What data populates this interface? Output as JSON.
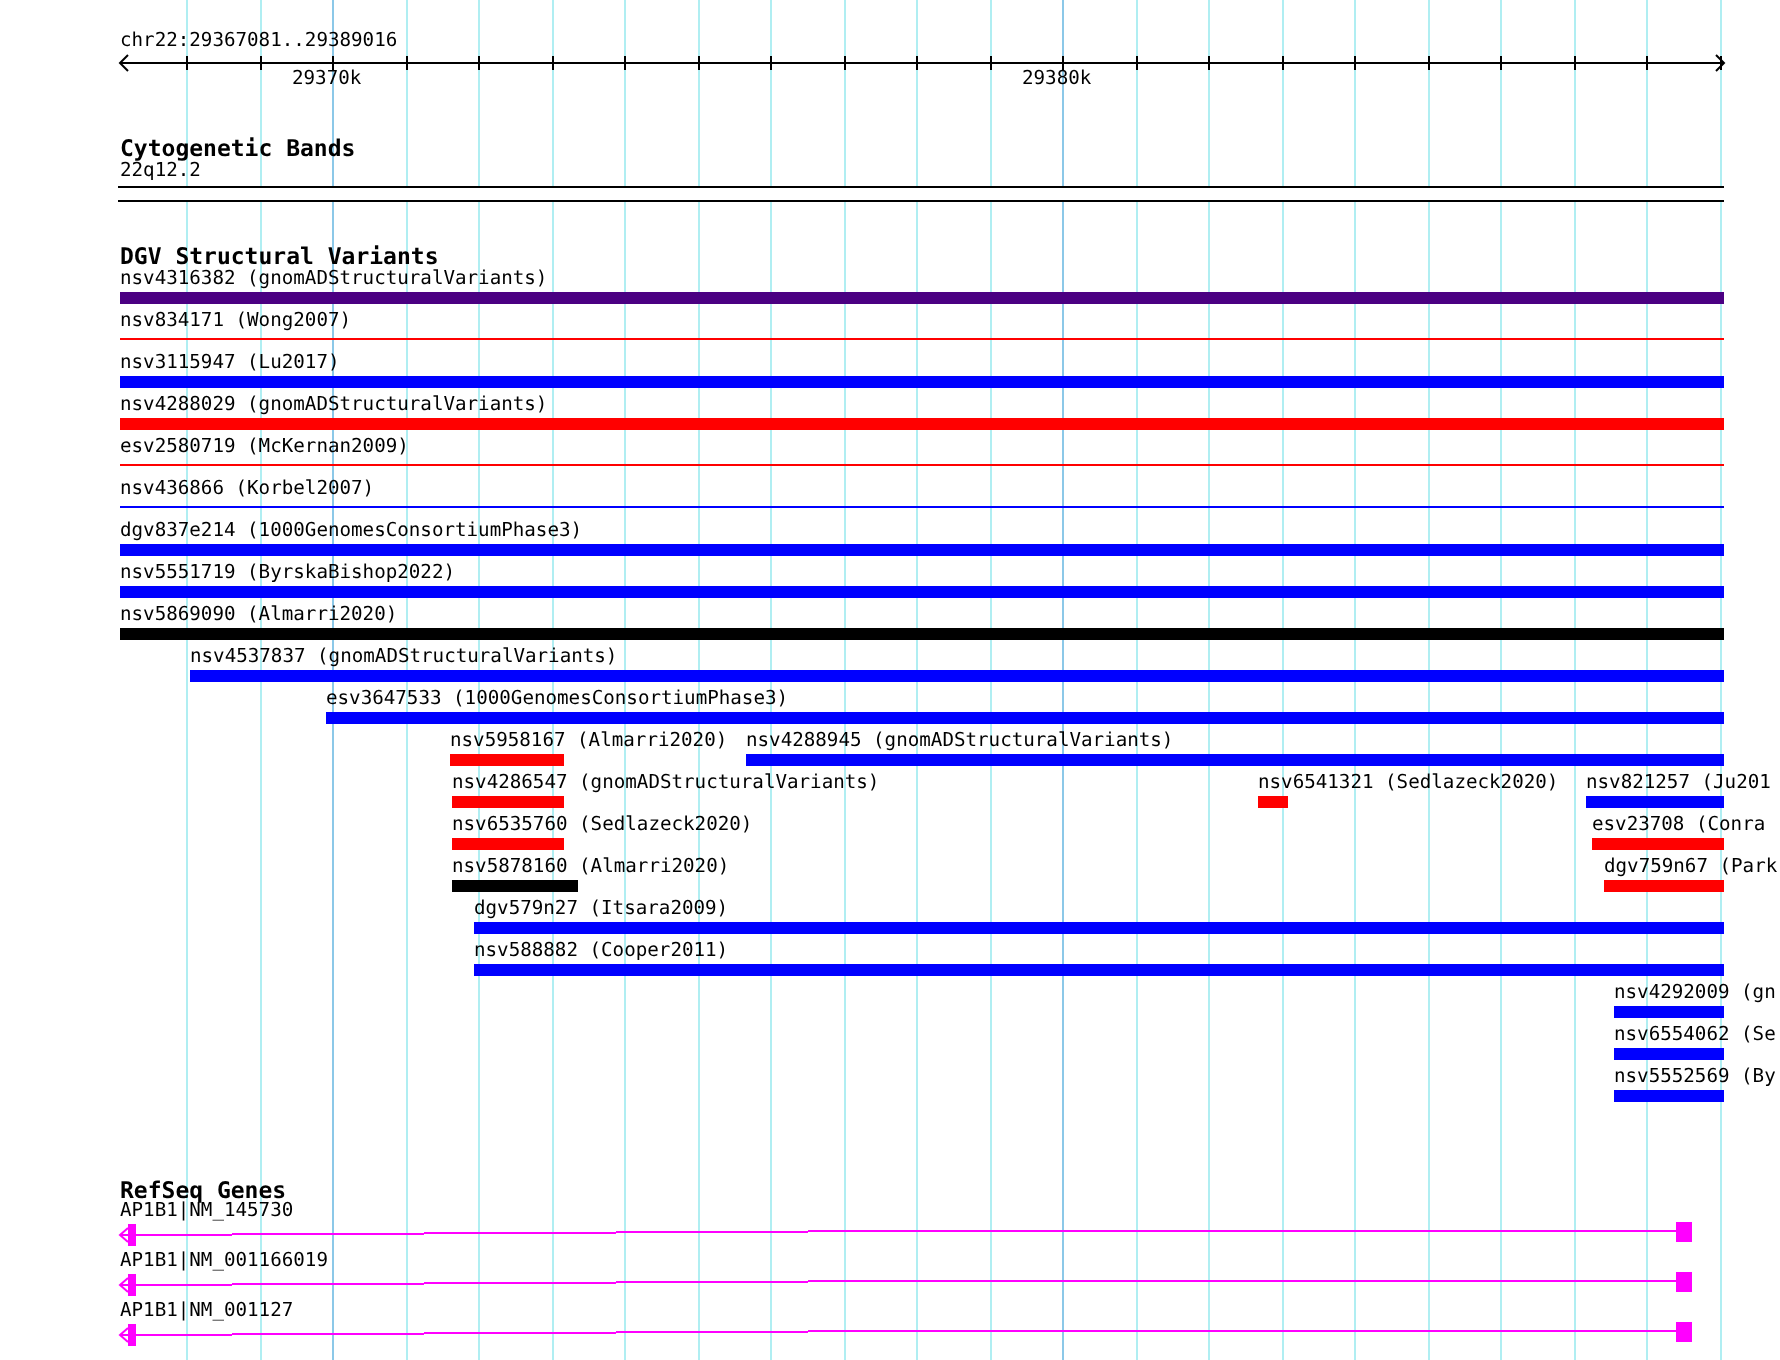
{
  "ruler": {
    "region": "chr22:29367081..29389016",
    "ticks": [
      {
        "label": "29370k"
      },
      {
        "label": "29380k"
      }
    ]
  },
  "tracks": [
    {
      "kind": "bands",
      "title": "Cytogenetic Bands",
      "features": [
        {
          "label": "22q12.2"
        }
      ]
    },
    {
      "kind": "variants",
      "title": "DGV Structural Variants",
      "rows": [
        [
          {
            "label": "nsv4316382 (gnomADStructuralVariants)",
            "color": "#4b0082",
            "kind": "thick"
          }
        ],
        [
          {
            "label": "nsv834171 (Wong2007)",
            "color": "#ff0000",
            "kind": "thin"
          }
        ],
        [
          {
            "label": "nsv3115947 (Lu2017)",
            "color": "#0000ff",
            "kind": "thick"
          }
        ],
        [
          {
            "label": "nsv4288029 (gnomADStructuralVariants)",
            "color": "#ff0000",
            "kind": "thick"
          }
        ],
        [
          {
            "label": "esv2580719 (McKernan2009)",
            "color": "#ff0000",
            "kind": "thin"
          }
        ],
        [
          {
            "label": "nsv436866 (Korbel2007)",
            "color": "#0000ff",
            "kind": "thin"
          }
        ],
        [
          {
            "label": "dgv837e214 (1000GenomesConsortiumPhase3)",
            "color": "#0000ff",
            "kind": "thick"
          }
        ],
        [
          {
            "label": "nsv5551719 (ByrskaBishop2022)",
            "color": "#0000ff",
            "kind": "thick"
          }
        ],
        [
          {
            "label": "nsv5869090 (Almarri2020)",
            "color": "#000000",
            "kind": "thick"
          }
        ],
        [
          {
            "label": "nsv4537837 (gnomADStructuralVariants)",
            "color": "#0000ff",
            "kind": "thick"
          }
        ],
        [
          {
            "label": "esv3647533 (1000GenomesConsortiumPhase3)",
            "color": "#0000ff",
            "kind": "thick"
          }
        ],
        [
          {
            "label": "nsv5958167 (Almarri2020)",
            "color": "#ff0000",
            "kind": "thick"
          },
          {
            "label": "nsv4288945 (gnomADStructuralVariants)",
            "color": "#0000ff",
            "kind": "thick"
          }
        ],
        [
          {
            "label": "nsv4286547 (gnomADStructuralVariants)",
            "color": "#ff0000",
            "kind": "thick"
          },
          {
            "label": "nsv6541321 (Sedlazeck2020)",
            "color": "#ff0000",
            "kind": "thick"
          },
          {
            "label": "nsv821257 (Ju201",
            "color": "#0000ff",
            "kind": "thick"
          }
        ],
        [
          {
            "label": "nsv6535760 (Sedlazeck2020)",
            "color": "#ff0000",
            "kind": "thick"
          },
          {
            "label": "esv23708 (Conra",
            "color": "#ff0000",
            "kind": "thick"
          }
        ],
        [
          {
            "label": "nsv5878160 (Almarri2020)",
            "color": "#000000",
            "kind": "thick"
          },
          {
            "label": "dgv759n67 (Park",
            "color": "#ff0000",
            "kind": "thick"
          }
        ],
        [
          {
            "label": "dgv579n27 (Itsara2009)",
            "color": "#0000ff",
            "kind": "thick"
          }
        ],
        [
          {
            "label": "nsv588882 (Cooper2011)",
            "color": "#0000ff",
            "kind": "thick"
          }
        ],
        [
          {
            "label": "nsv4292009 (gn",
            "color": "#0000ff",
            "kind": "thick"
          }
        ],
        [
          {
            "label": "nsv6554062 (Se",
            "color": "#0000ff",
            "kind": "thick"
          }
        ],
        [
          {
            "label": "nsv5552569 (By",
            "color": "#0000ff",
            "kind": "thick"
          }
        ]
      ]
    },
    {
      "kind": "genes",
      "title": "RefSeq Genes",
      "features": [
        {
          "label": "AP1B1|NM_145730"
        },
        {
          "label": "AP1B1|NM_001166019"
        },
        {
          "label": "AP1B1|NM_001127"
        }
      ]
    }
  ]
}
